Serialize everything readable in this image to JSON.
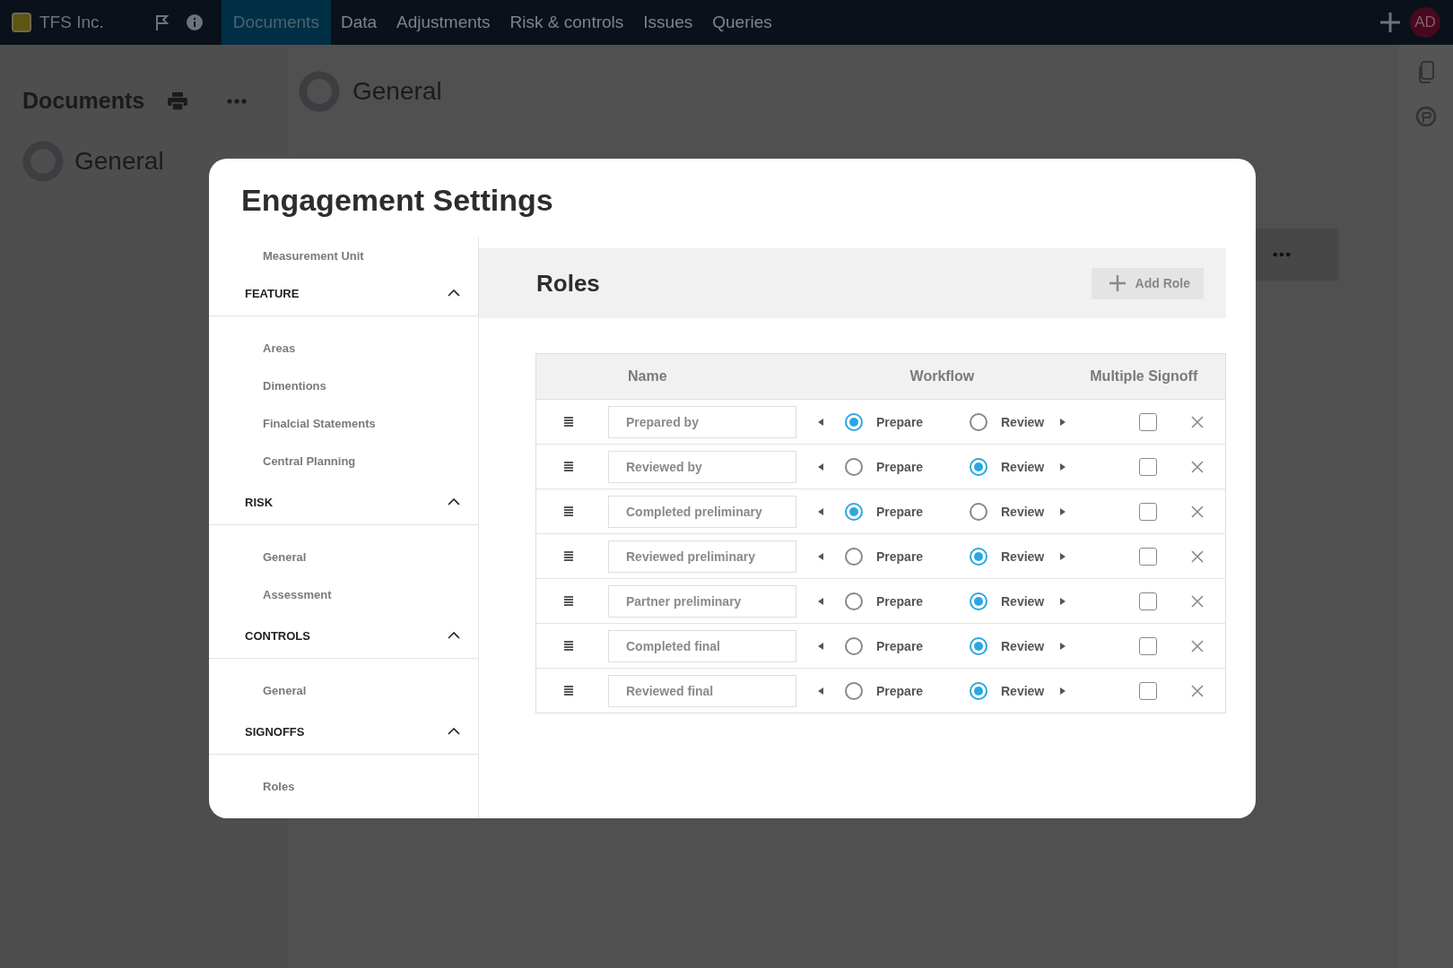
{
  "top_nav": {
    "brand": "TFS Inc.",
    "tabs": [
      {
        "label": "Documents",
        "selected": true
      },
      {
        "label": "Data",
        "selected": false
      },
      {
        "label": "Adjustments",
        "selected": false
      },
      {
        "label": "Risk & controls",
        "selected": false
      },
      {
        "label": "Issues",
        "selected": false
      },
      {
        "label": "Queries",
        "selected": false
      }
    ],
    "avatar": "AD"
  },
  "background": {
    "sidebar_title": "Documents",
    "sidebar_item": "General",
    "content_title": "General"
  },
  "modal": {
    "title": "Engagement Settings",
    "nav": [
      {
        "kind": "item",
        "label": "Measurement Unit"
      },
      {
        "kind": "section",
        "label": "FEATURE",
        "expanded": true,
        "children": [
          "Areas",
          "Dimentions",
          "Finalcial Statements",
          "Central Planning"
        ]
      },
      {
        "kind": "section",
        "label": "RISK",
        "expanded": true,
        "children": [
          "General",
          "Assessment"
        ]
      },
      {
        "kind": "section",
        "label": "CONTROLS",
        "expanded": true,
        "children": [
          "General"
        ]
      },
      {
        "kind": "section",
        "label": "SIGNOFFS",
        "expanded": true,
        "children": [
          "Roles"
        ]
      }
    ],
    "roles": {
      "title": "Roles",
      "add_button": "Add Role",
      "columns": [
        "Name",
        "Workflow",
        "Multiple Signoff"
      ],
      "rows": [
        {
          "name": "Prepared by",
          "prepare": {
            "label": "Prepare",
            "selected": true
          },
          "review": {
            "label": "Review",
            "selected": false
          },
          "multiple_signoff": false
        },
        {
          "name": "Reviewed by",
          "prepare": {
            "label": "Prepare",
            "selected": false
          },
          "review": {
            "label": "Review",
            "selected": true
          },
          "multiple_signoff": false
        },
        {
          "name": "Completed preliminary",
          "prepare": {
            "label": "Prepare",
            "selected": true
          },
          "review": {
            "label": "Review",
            "selected": false
          },
          "multiple_signoff": false
        },
        {
          "name": "Reviewed preliminary",
          "prepare": {
            "label": "Prepare",
            "selected": false
          },
          "review": {
            "label": "Review",
            "selected": true
          },
          "multiple_signoff": false
        },
        {
          "name": "Partner preliminary",
          "prepare": {
            "label": "Prepare",
            "selected": false
          },
          "review": {
            "label": "Review",
            "selected": true
          },
          "multiple_signoff": false
        },
        {
          "name": "Completed final",
          "prepare": {
            "label": "Prepare",
            "selected": false
          },
          "review": {
            "label": "Review",
            "selected": true
          },
          "multiple_signoff": false
        },
        {
          "name": "Reviewed final",
          "prepare": {
            "label": "Prepare",
            "selected": false
          },
          "review": {
            "label": "Review",
            "selected": true
          },
          "multiple_signoff": false
        }
      ]
    }
  }
}
